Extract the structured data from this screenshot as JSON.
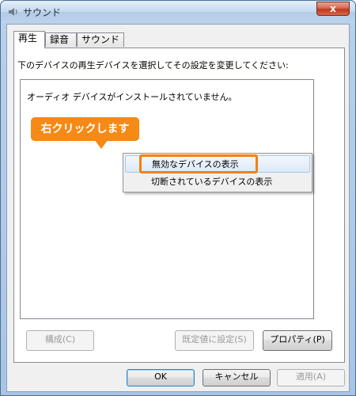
{
  "window": {
    "title": "サウンド",
    "close_label": "x"
  },
  "tabs": [
    {
      "label": "再生",
      "active": true
    },
    {
      "label": "録音",
      "active": false
    },
    {
      "label": "サウンド",
      "active": false
    }
  ],
  "instruction": "下のデバイスの再生デバイスを選択してその設定を変更してください:",
  "device_list": {
    "empty_message": "オーディオ デバイスがインストールされていません。"
  },
  "callout": {
    "text": "右クリックします",
    "color": "#f58a17"
  },
  "context_menu": {
    "items": [
      {
        "label": "無効なデバイスの表示",
        "highlighted": true
      },
      {
        "label": "切断されているデバイスの表示",
        "highlighted": false
      }
    ]
  },
  "panel_buttons": {
    "configure": "構成(C)",
    "set_default": "既定値に設定(S)",
    "properties": "プロパティ(P)"
  },
  "dialog_buttons": {
    "ok": "OK",
    "cancel": "キャンセル",
    "apply": "適用(A)"
  }
}
